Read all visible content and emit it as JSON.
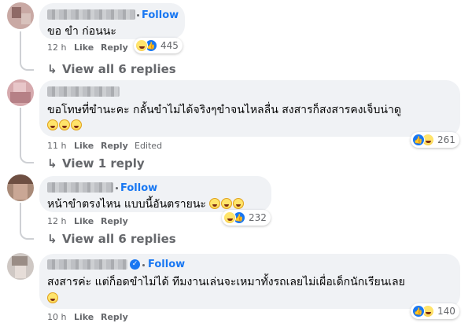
{
  "comments": [
    {
      "follow": "Follow",
      "text": "ขอ ขำ ก่อนนะ",
      "time": "12 h",
      "like": "Like",
      "reply": "Reply",
      "reaction_count": "445",
      "reactions": [
        "like-icon",
        "haha-icon"
      ],
      "view_replies": "View all 6 replies"
    },
    {
      "text": "ขอโทษที่ขำนะคะ กลั้นขำไม่ได้จริงๆขำจนไหลลื่น สงสารก็สงสารคงเจ็บน่าดู",
      "emoji_line": "🤣🤣🤣",
      "time": "11 h",
      "like": "Like",
      "reply": "Reply",
      "edited": "Edited",
      "reaction_count": "261",
      "reactions": [
        "like-icon",
        "haha-icon"
      ],
      "view_replies": "View 1 reply"
    },
    {
      "follow": "Follow",
      "text": "หน้าขำตรงไหน แบบนี้อันตรายนะ",
      "time": "12 h",
      "like": "Like",
      "reply": "Reply",
      "reaction_count": "232",
      "reactions": [
        "haha-icon",
        "like-icon"
      ],
      "view_replies": "View all 6 replies"
    },
    {
      "follow": "Follow",
      "text": "สงสารค่ะ แต่ก็อดขำไม่ได้ ทีมงานเล่นจะเหมาทั้งรถเลยไม่เผื่อเด็กนักเรียนเลย",
      "emoji_line": "😁",
      "time": "10 h",
      "like": "Like",
      "reply": "Reply",
      "reaction_count": "140",
      "reactions": [
        "like-icon",
        "haha-icon"
      ]
    }
  ],
  "colors": {
    "bubble": "#f0f2f5",
    "link": "#1877f2",
    "meta": "#65676b"
  }
}
